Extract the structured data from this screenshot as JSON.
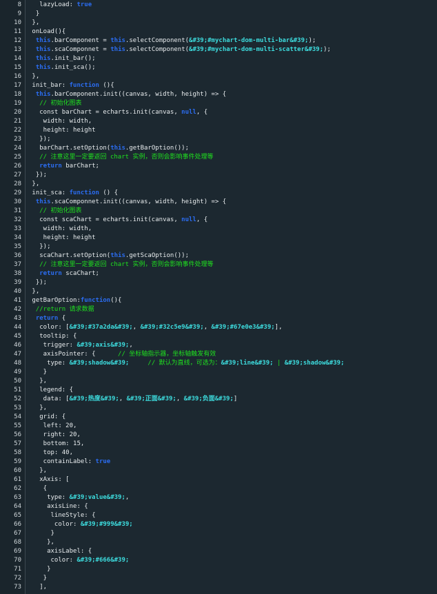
{
  "editor": {
    "colors": {
      "background": "#1c2830",
      "default": "#e8ecee",
      "keyword": "#2b6df2",
      "string": "#3ddcde",
      "comment": "#1fe01f",
      "line_number": "#cfd6da"
    },
    "lines": [
      {
        "n": "8",
        "tokens": [
          [
            "d",
            "   lazyLoad: "
          ],
          [
            "k",
            "true"
          ]
        ]
      },
      {
        "n": "9",
        "tokens": [
          [
            "d",
            "  }"
          ]
        ]
      },
      {
        "n": "10",
        "tokens": [
          [
            "d",
            " },"
          ]
        ]
      },
      {
        "n": "11",
        "tokens": [
          [
            "d",
            " onLoad(){"
          ]
        ]
      },
      {
        "n": "12",
        "tokens": [
          [
            "d",
            "  "
          ],
          [
            "k",
            "this"
          ],
          [
            "d",
            ".barComponent = "
          ],
          [
            "k",
            "this"
          ],
          [
            "d",
            ".selectComponent("
          ],
          [
            "s",
            "&#39;#mychart-dom-multi-bar&#39;"
          ],
          [
            "d",
            ");"
          ]
        ]
      },
      {
        "n": "13",
        "tokens": [
          [
            "d",
            "  "
          ],
          [
            "k",
            "this"
          ],
          [
            "d",
            ".scaComponnet = "
          ],
          [
            "k",
            "this"
          ],
          [
            "d",
            ".selectComponent("
          ],
          [
            "s",
            "&#39;#mychart-dom-multi-scatter&#39;"
          ],
          [
            "d",
            ");"
          ]
        ]
      },
      {
        "n": "14",
        "tokens": [
          [
            "d",
            "  "
          ],
          [
            "k",
            "this"
          ],
          [
            "d",
            ".init_bar();"
          ]
        ]
      },
      {
        "n": "15",
        "tokens": [
          [
            "d",
            "  "
          ],
          [
            "k",
            "this"
          ],
          [
            "d",
            ".init_sca();"
          ]
        ]
      },
      {
        "n": "16",
        "tokens": [
          [
            "d",
            " },"
          ]
        ]
      },
      {
        "n": "17",
        "tokens": [
          [
            "d",
            " init_bar: "
          ],
          [
            "k",
            "function"
          ],
          [
            "d",
            " (){"
          ]
        ]
      },
      {
        "n": "18",
        "tokens": [
          [
            "d",
            "  "
          ],
          [
            "k",
            "this"
          ],
          [
            "d",
            ".barComponent.init((canvas, width, height) => {"
          ]
        ]
      },
      {
        "n": "19",
        "tokens": [
          [
            "d",
            "   "
          ],
          [
            "c",
            "// 初始化图表"
          ]
        ]
      },
      {
        "n": "20",
        "tokens": [
          [
            "d",
            "   const barChart = echarts.init(canvas, "
          ],
          [
            "k",
            "null"
          ],
          [
            "d",
            ", {"
          ]
        ]
      },
      {
        "n": "21",
        "tokens": [
          [
            "d",
            "    width: width,"
          ]
        ]
      },
      {
        "n": "22",
        "tokens": [
          [
            "d",
            "    height: height"
          ]
        ]
      },
      {
        "n": "23",
        "tokens": [
          [
            "d",
            "   });"
          ]
        ]
      },
      {
        "n": "24",
        "tokens": [
          [
            "d",
            "   barChart.setOption("
          ],
          [
            "k",
            "this"
          ],
          [
            "d",
            ".getBarOption());"
          ]
        ]
      },
      {
        "n": "25",
        "tokens": [
          [
            "d",
            "   "
          ],
          [
            "c",
            "// 注意这里一定要返回 chart 实例，否则会影响事件处理等"
          ]
        ]
      },
      {
        "n": "26",
        "tokens": [
          [
            "d",
            "   "
          ],
          [
            "k",
            "return"
          ],
          [
            "d",
            " barChart;"
          ]
        ]
      },
      {
        "n": "27",
        "tokens": [
          [
            "d",
            "  });"
          ]
        ]
      },
      {
        "n": "28",
        "tokens": [
          [
            "d",
            " },"
          ]
        ]
      },
      {
        "n": "29",
        "tokens": [
          [
            "d",
            " init_sca: "
          ],
          [
            "k",
            "function"
          ],
          [
            "d",
            " () {"
          ]
        ]
      },
      {
        "n": "30",
        "tokens": [
          [
            "d",
            "  "
          ],
          [
            "k",
            "this"
          ],
          [
            "d",
            ".scaComponnet.init((canvas, width, height) => {"
          ]
        ]
      },
      {
        "n": "31",
        "tokens": [
          [
            "d",
            "   "
          ],
          [
            "c",
            "// 初始化图表"
          ]
        ]
      },
      {
        "n": "32",
        "tokens": [
          [
            "d",
            "   const scaChart = echarts.init(canvas, "
          ],
          [
            "k",
            "null"
          ],
          [
            "d",
            ", {"
          ]
        ]
      },
      {
        "n": "33",
        "tokens": [
          [
            "d",
            "    width: width,"
          ]
        ]
      },
      {
        "n": "34",
        "tokens": [
          [
            "d",
            "    height: height"
          ]
        ]
      },
      {
        "n": "35",
        "tokens": [
          [
            "d",
            "   });"
          ]
        ]
      },
      {
        "n": "36",
        "tokens": [
          [
            "d",
            "   scaChart.setOption("
          ],
          [
            "k",
            "this"
          ],
          [
            "d",
            ".getScaOption());"
          ]
        ]
      },
      {
        "n": "37",
        "tokens": [
          [
            "d",
            "   "
          ],
          [
            "c",
            "// 注意这里一定要返回 chart 实例，否则会影响事件处理等"
          ]
        ]
      },
      {
        "n": "38",
        "tokens": [
          [
            "d",
            "   "
          ],
          [
            "k",
            "return"
          ],
          [
            "d",
            " scaChart;"
          ]
        ]
      },
      {
        "n": "39",
        "tokens": [
          [
            "d",
            "  });"
          ]
        ]
      },
      {
        "n": "40",
        "tokens": [
          [
            "d",
            " },"
          ]
        ]
      },
      {
        "n": "41",
        "tokens": [
          [
            "d",
            " getBarOption:"
          ],
          [
            "k",
            "function"
          ],
          [
            "d",
            "(){"
          ]
        ]
      },
      {
        "n": "42",
        "tokens": [
          [
            "d",
            "  "
          ],
          [
            "c",
            "//return 请求数据"
          ]
        ]
      },
      {
        "n": "43",
        "tokens": [
          [
            "d",
            "  "
          ],
          [
            "k",
            "return"
          ],
          [
            "d",
            " {"
          ]
        ]
      },
      {
        "n": "44",
        "tokens": [
          [
            "d",
            "   color: ["
          ],
          [
            "s",
            "&#39;#37a2da&#39;"
          ],
          [
            "d",
            ", "
          ],
          [
            "s",
            "&#39;#32c5e9&#39;"
          ],
          [
            "d",
            ", "
          ],
          [
            "s",
            "&#39;#67e0e3&#39;"
          ],
          [
            "d",
            "],"
          ]
        ]
      },
      {
        "n": "45",
        "tokens": [
          [
            "d",
            "   tooltip: {"
          ]
        ]
      },
      {
        "n": "46",
        "tokens": [
          [
            "d",
            "    trigger: "
          ],
          [
            "s",
            "&#39;axis&#39;"
          ],
          [
            "d",
            ","
          ]
        ]
      },
      {
        "n": "47",
        "tokens": [
          [
            "d",
            "    axisPointer: {      "
          ],
          [
            "c",
            "// 坐标轴指示器，坐标轴触发有效"
          ]
        ]
      },
      {
        "n": "48",
        "tokens": [
          [
            "d",
            "     type: "
          ],
          [
            "s",
            "&#39;shadow&#39;"
          ],
          [
            "d",
            "     "
          ],
          [
            "c",
            "// 默认为直线，可选为："
          ],
          [
            "s",
            "&#39;line&#39;"
          ],
          [
            "c",
            " | "
          ],
          [
            "s",
            "&#39;shadow&#39;"
          ]
        ]
      },
      {
        "n": "49",
        "tokens": [
          [
            "d",
            "    }"
          ]
        ]
      },
      {
        "n": "50",
        "tokens": [
          [
            "d",
            "   },"
          ]
        ]
      },
      {
        "n": "51",
        "tokens": [
          [
            "d",
            "   legend: {"
          ]
        ]
      },
      {
        "n": "52",
        "tokens": [
          [
            "d",
            "    data: ["
          ],
          [
            "s",
            "&#39;热度&#39;"
          ],
          [
            "d",
            ", "
          ],
          [
            "s",
            "&#39;正面&#39;"
          ],
          [
            "d",
            ", "
          ],
          [
            "s",
            "&#39;负面&#39;"
          ],
          [
            "d",
            "]"
          ]
        ]
      },
      {
        "n": "53",
        "tokens": [
          [
            "d",
            "   },"
          ]
        ]
      },
      {
        "n": "54",
        "tokens": [
          [
            "d",
            "   grid: {"
          ]
        ]
      },
      {
        "n": "55",
        "tokens": [
          [
            "d",
            "    left: 20,"
          ]
        ]
      },
      {
        "n": "56",
        "tokens": [
          [
            "d",
            "    right: 20,"
          ]
        ]
      },
      {
        "n": "57",
        "tokens": [
          [
            "d",
            "    bottom: 15,"
          ]
        ]
      },
      {
        "n": "58",
        "tokens": [
          [
            "d",
            "    top: 40,"
          ]
        ]
      },
      {
        "n": "59",
        "tokens": [
          [
            "d",
            "    containLabel: "
          ],
          [
            "k",
            "true"
          ]
        ]
      },
      {
        "n": "60",
        "tokens": [
          [
            "d",
            "   },"
          ]
        ]
      },
      {
        "n": "61",
        "tokens": [
          [
            "d",
            "   xAxis: ["
          ]
        ]
      },
      {
        "n": "62",
        "tokens": [
          [
            "d",
            "    {"
          ]
        ]
      },
      {
        "n": "63",
        "tokens": [
          [
            "d",
            "     type: "
          ],
          [
            "s",
            "&#39;value&#39;"
          ],
          [
            "d",
            ","
          ]
        ]
      },
      {
        "n": "64",
        "tokens": [
          [
            "d",
            "     axisLine: {"
          ]
        ]
      },
      {
        "n": "65",
        "tokens": [
          [
            "d",
            "      lineStyle: {"
          ]
        ]
      },
      {
        "n": "66",
        "tokens": [
          [
            "d",
            "       color: "
          ],
          [
            "s",
            "&#39;#999&#39;"
          ]
        ]
      },
      {
        "n": "67",
        "tokens": [
          [
            "d",
            "      }"
          ]
        ]
      },
      {
        "n": "68",
        "tokens": [
          [
            "d",
            "     },"
          ]
        ]
      },
      {
        "n": "69",
        "tokens": [
          [
            "d",
            "     axisLabel: {"
          ]
        ]
      },
      {
        "n": "70",
        "tokens": [
          [
            "d",
            "      color: "
          ],
          [
            "s",
            "&#39;#666&#39;"
          ]
        ]
      },
      {
        "n": "71",
        "tokens": [
          [
            "d",
            "     }"
          ]
        ]
      },
      {
        "n": "72",
        "tokens": [
          [
            "d",
            "    }"
          ]
        ]
      },
      {
        "n": "73",
        "tokens": [
          [
            "d",
            "   ],"
          ]
        ]
      }
    ]
  }
}
